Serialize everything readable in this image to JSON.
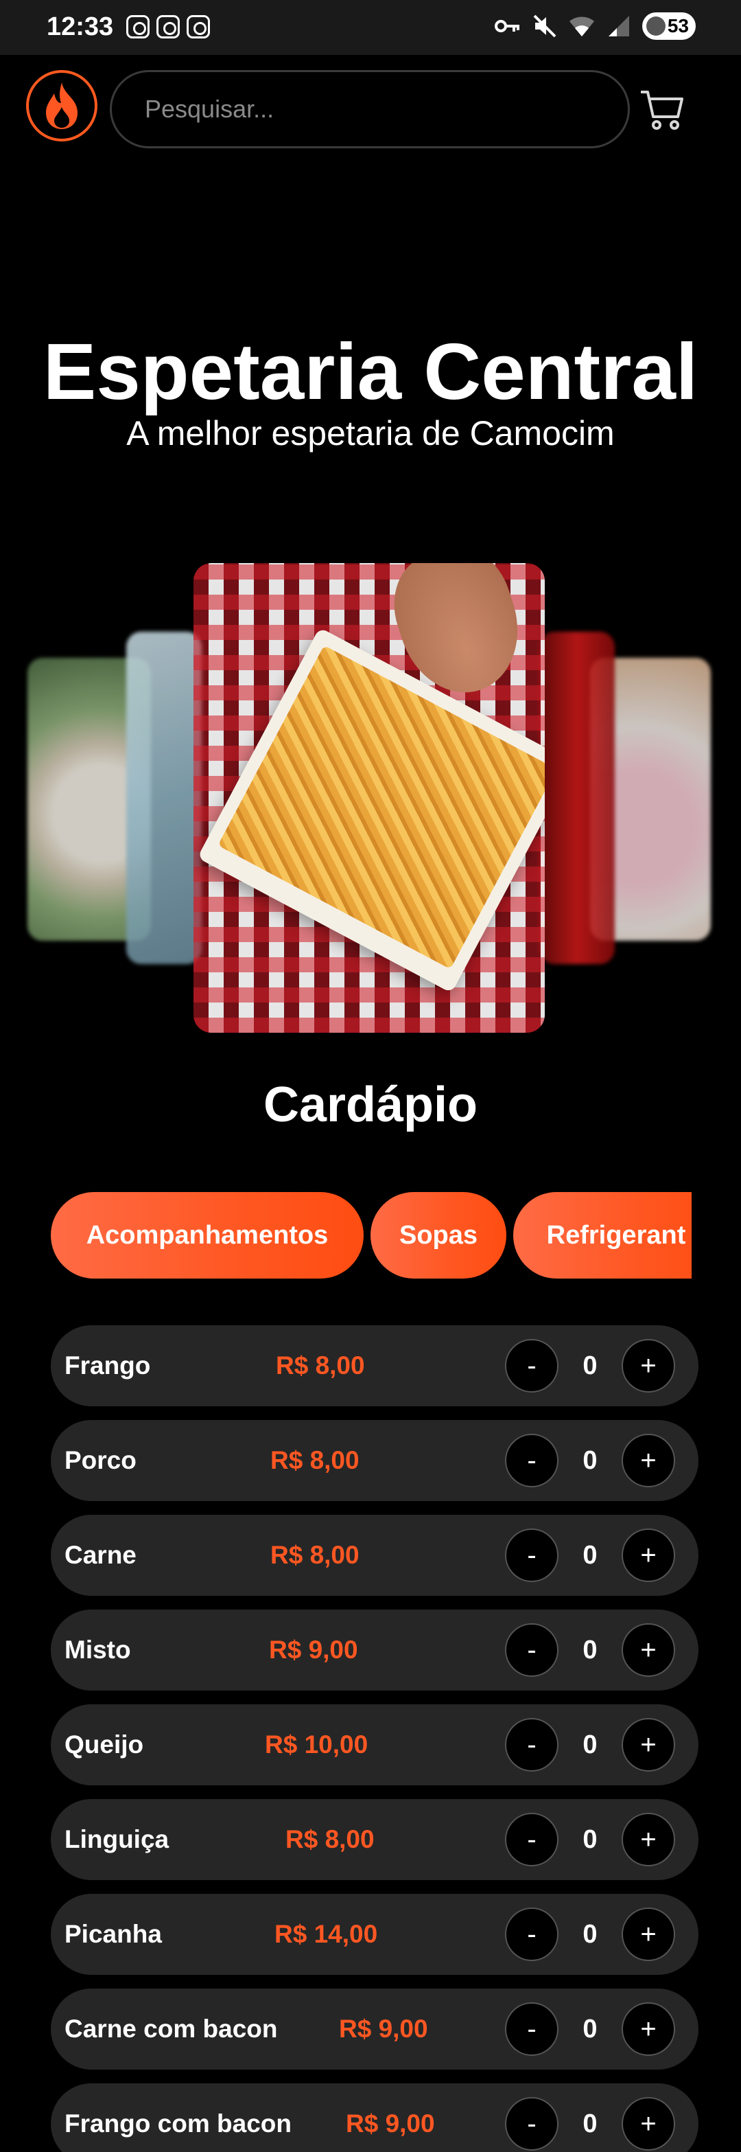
{
  "status_bar": {
    "time": "12:33",
    "battery": "53",
    "app_icons": [
      "screenshot-icon",
      "instagram-icon",
      "instagram-icon"
    ],
    "right_icons": [
      "key-icon",
      "mute-icon",
      "wifi-icon",
      "signal-icon"
    ]
  },
  "header": {
    "logo_icon": "flame-logo-icon",
    "search_placeholder": "Pesquisar...",
    "cart_icon": "cart-icon",
    "accent_color": "#ff5722"
  },
  "hero": {
    "title": "Espetaria Central",
    "subtitle": "A melhor espetaria de Camocim"
  },
  "carousel": {
    "images": [
      "rice-dish",
      "blue-dish",
      "french-fries",
      "coca-cola",
      "strawberry-shake"
    ],
    "active_index": 2
  },
  "menu": {
    "title": "Cardápio",
    "tabs": [
      "Acompanhamentos",
      "Sopas",
      "Refrigerant"
    ],
    "items": [
      {
        "name": "Frango",
        "price": "R$ 8,00",
        "qty": "0",
        "minus": "-",
        "plus": "+"
      },
      {
        "name": "Porco",
        "price": "R$ 8,00",
        "qty": "0",
        "minus": "-",
        "plus": "+"
      },
      {
        "name": "Carne",
        "price": "R$ 8,00",
        "qty": "0",
        "minus": "-",
        "plus": "+"
      },
      {
        "name": "Misto",
        "price": "R$ 9,00",
        "qty": "0",
        "minus": "-",
        "plus": "+"
      },
      {
        "name": "Queijo",
        "price": "R$ 10,00",
        "qty": "0",
        "minus": "-",
        "plus": "+"
      },
      {
        "name": "Linguiça",
        "price": "R$ 8,00",
        "qty": "0",
        "minus": "-",
        "plus": "+"
      },
      {
        "name": "Picanha",
        "price": "R$ 14,00",
        "qty": "0",
        "minus": "-",
        "plus": "+"
      },
      {
        "name": "Carne com bacon",
        "price": "R$ 9,00",
        "qty": "0",
        "minus": "-",
        "plus": "+"
      },
      {
        "name": "Frango com bacon",
        "price": "R$ 9,00",
        "qty": "0",
        "minus": "-",
        "plus": "+"
      }
    ]
  }
}
